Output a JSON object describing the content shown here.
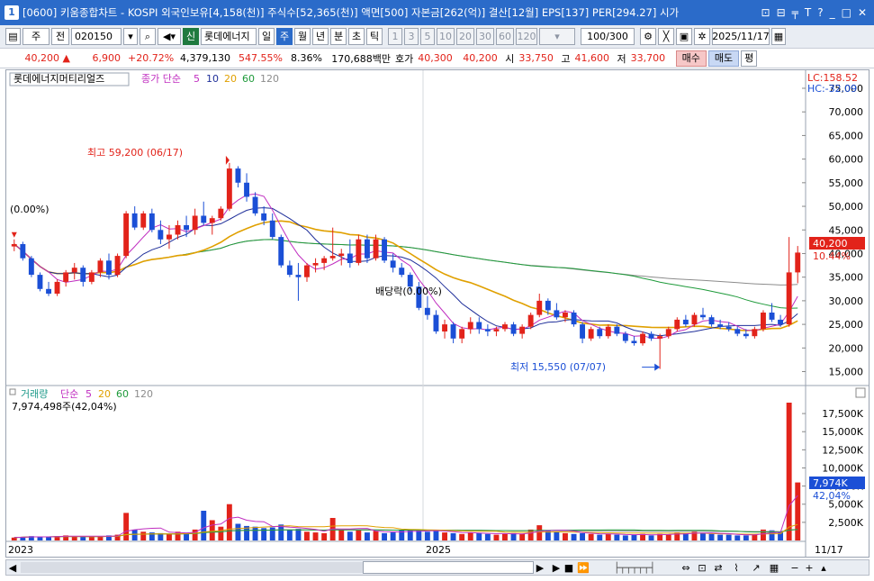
{
  "window": {
    "num": "1",
    "title": "[0600] 키움종합차트 - KOSPI 외국인보유[4,158(천)] 주식수[52,365(천)] 액면[500] 자본금[262(억)] 결산[12월] EPS[137] PER[294.27] 시가",
    "buttons": [
      "⊡",
      "⊟",
      "╤",
      "T",
      "?",
      "_",
      "□",
      "✕"
    ]
  },
  "toolbar1": {
    "period_type": "주",
    "all_label": "전",
    "code": "020150",
    "new_label": "신",
    "stock_name": "롯데에너지",
    "period_buttons": [
      "일",
      "주",
      "월",
      "년",
      "분",
      "초",
      "틱"
    ],
    "active_period": "주",
    "interval_buttons": [
      "1",
      "3",
      "5",
      "10",
      "20",
      "30",
      "60",
      "120"
    ],
    "count": "100",
    "count_max": "/300",
    "date": "2025/11/17"
  },
  "toolbar2": {
    "price": "40,200",
    "change": "6,900",
    "change_pct": "+20.72%",
    "volume": "4,379,130",
    "vol_ratio": "547.55%",
    "turnover": "8.36%",
    "amount": "170,688백만",
    "ask_label": "호가",
    "ask1": "40,300",
    "ask2": "40,200",
    "open_label": "시",
    "open": "33,750",
    "high_label": "고",
    "high": "41,600",
    "low_label": "저",
    "low": "33,700",
    "buy": "매수",
    "sell": "매도",
    "avg": "평"
  },
  "colors": {
    "up": "#e2231a",
    "down": "#1b4fd6",
    "ma5": "#c02ec0",
    "ma10": "#1f2f9a",
    "ma20": "#e0a000",
    "ma60": "#1e9a3a",
    "ma120": "#8c8c8c"
  },
  "price_panel": {
    "stock_label": "롯데에너지머티리얼즈",
    "legend_close": "종가 단순",
    "ma": [
      "5",
      "10",
      "20",
      "60",
      "120"
    ],
    "lc": "LC:158.52",
    "hc": "HC:-32.09",
    "last_price": "40,200",
    "last_pct": "10.44%",
    "high_note": "최고 59,200 (06/17)",
    "low_note": "최저 15,550 (07/07)",
    "zero_note": "(0.00%)",
    "div_note": "배당락(0.00%)",
    "y_ticks": [
      "15,000",
      "20,000",
      "25,000",
      "30,000",
      "35,000",
      "40,000",
      "45,000",
      "50,000",
      "55,000",
      "60,000",
      "65,000",
      "70,000",
      "75,000"
    ]
  },
  "volume_panel": {
    "label": "거래량",
    "legend_simple": "단순",
    "ma": [
      "5",
      "20",
      "60",
      "120"
    ],
    "value_text": "7,974,498주(42,04%)",
    "last_vol": "7,974K",
    "last_pct": "42,04%",
    "y_ticks": [
      "2,500K",
      "5,000K",
      "7,500K",
      "10,000K",
      "12,500K",
      "15,000K",
      "17,500K"
    ]
  },
  "x_labels": [
    "2023",
    "2025",
    "11/17"
  ],
  "chart_data": {
    "type": "candlestick",
    "period": "weekly",
    "x_labels": [
      "2023",
      "2025",
      "11/17"
    ],
    "price_range": [
      13000,
      75000
    ],
    "volume_range": [
      0,
      19500000
    ],
    "ohlc": [
      [
        41500,
        43000,
        40500,
        42000
      ],
      [
        42000,
        42500,
        38500,
        39000
      ],
      [
        39000,
        39500,
        35000,
        35500
      ],
      [
        35500,
        36000,
        32000,
        32500
      ],
      [
        32500,
        34000,
        31000,
        31500
      ],
      [
        31500,
        34500,
        31000,
        34000
      ],
      [
        34000,
        36500,
        33000,
        36000
      ],
      [
        36000,
        38000,
        34500,
        37000
      ],
      [
        37000,
        37500,
        33000,
        34000
      ],
      [
        34000,
        36500,
        33500,
        36000
      ],
      [
        36000,
        39000,
        35000,
        38500
      ],
      [
        38500,
        40000,
        34500,
        35500
      ],
      [
        35500,
        40000,
        35000,
        39500
      ],
      [
        39500,
        49000,
        39000,
        48500
      ],
      [
        48500,
        50000,
        45000,
        45500
      ],
      [
        45500,
        49000,
        45000,
        48500
      ],
      [
        48500,
        49500,
        44500,
        45000
      ],
      [
        45000,
        47000,
        42000,
        43000
      ],
      [
        43000,
        46000,
        41000,
        44000
      ],
      [
        44000,
        47000,
        43000,
        46000
      ],
      [
        46000,
        48000,
        43500,
        45000
      ],
      [
        45000,
        49500,
        44000,
        48000
      ],
      [
        48000,
        51000,
        46000,
        46500
      ],
      [
        46500,
        48000,
        44000,
        47500
      ],
      [
        47500,
        50000,
        47000,
        49500
      ],
      [
        49500,
        59200,
        49000,
        58000
      ],
      [
        58000,
        58500,
        54000,
        55000
      ],
      [
        55000,
        57000,
        51000,
        52000
      ],
      [
        52000,
        53000,
        48000,
        48500
      ],
      [
        48500,
        50000,
        46000,
        47000
      ],
      [
        47000,
        48500,
        43000,
        43500
      ],
      [
        43500,
        44000,
        37000,
        37500
      ],
      [
        37500,
        38500,
        35000,
        35500
      ],
      [
        35500,
        38000,
        30000,
        35000
      ],
      [
        35000,
        38000,
        34000,
        37500
      ],
      [
        37500,
        39000,
        36000,
        38000
      ],
      [
        38000,
        39500,
        36500,
        39000
      ],
      [
        39000,
        45500,
        38500,
        39500
      ],
      [
        39500,
        41000,
        37500,
        40000
      ],
      [
        40000,
        43000,
        37000,
        38000
      ],
      [
        38000,
        44000,
        37500,
        43000
      ],
      [
        43000,
        44000,
        38000,
        39000
      ],
      [
        39000,
        44000,
        38500,
        43000
      ],
      [
        43000,
        43500,
        38000,
        38500
      ],
      [
        38500,
        40000,
        36000,
        37000
      ],
      [
        37000,
        38000,
        35000,
        35500
      ],
      [
        35500,
        36000,
        32000,
        33000
      ],
      [
        33000,
        34000,
        28000,
        28500
      ],
      [
        28500,
        31000,
        26000,
        27000
      ],
      [
        27000,
        28000,
        23000,
        23500
      ],
      [
        23500,
        26000,
        22000,
        25000
      ],
      [
        25000,
        25500,
        21000,
        22000
      ],
      [
        22000,
        24500,
        21000,
        24000
      ],
      [
        24000,
        26500,
        23000,
        25500
      ],
      [
        25500,
        26500,
        23000,
        24000
      ],
      [
        24000,
        25000,
        22500,
        23500
      ],
      [
        23500,
        24500,
        22500,
        24000
      ],
      [
        24000,
        25500,
        23500,
        25000
      ],
      [
        25000,
        25500,
        22500,
        23000
      ],
      [
        23000,
        25000,
        22000,
        24500
      ],
      [
        24500,
        27500,
        24000,
        27000
      ],
      [
        27000,
        31500,
        26500,
        30000
      ],
      [
        30000,
        30500,
        27000,
        28000
      ],
      [
        28000,
        29500,
        26000,
        26500
      ],
      [
        26500,
        28000,
        25500,
        27500
      ],
      [
        27500,
        28000,
        24500,
        25000
      ],
      [
        25000,
        25500,
        21000,
        22000
      ],
      [
        22000,
        24500,
        21500,
        24000
      ],
      [
        24000,
        24500,
        22000,
        22500
      ],
      [
        22500,
        25000,
        22000,
        24500
      ],
      [
        24500,
        25000,
        22500,
        23000
      ],
      [
        23000,
        23500,
        21000,
        21500
      ],
      [
        21500,
        22500,
        20500,
        21000
      ],
      [
        21000,
        23500,
        20500,
        23000
      ],
      [
        23000,
        23500,
        21500,
        22000
      ],
      [
        22000,
        23000,
        15550,
        22500
      ],
      [
        22500,
        24500,
        22000,
        24000
      ],
      [
        24000,
        26500,
        23500,
        26000
      ],
      [
        26000,
        27000,
        24500,
        25000
      ],
      [
        25000,
        27500,
        24500,
        27000
      ],
      [
        27000,
        28500,
        26000,
        26500
      ],
      [
        26500,
        27000,
        24500,
        25000
      ],
      [
        25000,
        26000,
        24000,
        24500
      ],
      [
        24500,
        25500,
        23500,
        24000
      ],
      [
        24000,
        24500,
        22500,
        23000
      ],
      [
        23000,
        24000,
        22000,
        22500
      ],
      [
        22500,
        24500,
        22000,
        24000
      ],
      [
        24000,
        28000,
        23500,
        27500
      ],
      [
        27500,
        29500,
        25500,
        26000
      ],
      [
        26000,
        27000,
        24500,
        25000
      ],
      [
        25000,
        43500,
        24500,
        36000
      ],
      [
        36000,
        41600,
        33700,
        40200
      ]
    ],
    "volume": [
      400000,
      500000,
      600000,
      500000,
      500000,
      600000,
      700000,
      600000,
      500000,
      500000,
      600000,
      700000,
      800000,
      3800000,
      1500000,
      1200000,
      1100000,
      1000000,
      900000,
      1200000,
      1000000,
      1500000,
      4100000,
      2800000,
      1900000,
      5000000,
      2300000,
      2000000,
      1900000,
      1700000,
      1800000,
      2200000,
      1500000,
      1600000,
      1200000,
      1100000,
      1000000,
      3100000,
      1500000,
      1200000,
      1400000,
      1100000,
      1300000,
      1000000,
      1100000,
      1400000,
      1500000,
      1400000,
      1200000,
      1300000,
      1100000,
      1000000,
      900000,
      1100000,
      1000000,
      900000,
      800000,
      900000,
      1000000,
      900000,
      1500000,
      2100000,
      1300000,
      1200000,
      1000000,
      900000,
      1000000,
      900000,
      800000,
      900000,
      800000,
      700000,
      800000,
      900000,
      700000,
      900000,
      800000,
      1100000,
      1000000,
      1200000,
      1000000,
      900000,
      800000,
      800000,
      700000,
      700000,
      900000,
      1500000,
      1400000,
      1100000,
      19000000,
      8000000
    ],
    "series": [
      {
        "name": "5",
        "type": "ma"
      },
      {
        "name": "10",
        "type": "ma"
      },
      {
        "name": "20",
        "type": "ma"
      },
      {
        "name": "60",
        "type": "ma"
      },
      {
        "name": "120",
        "type": "ma"
      }
    ]
  }
}
